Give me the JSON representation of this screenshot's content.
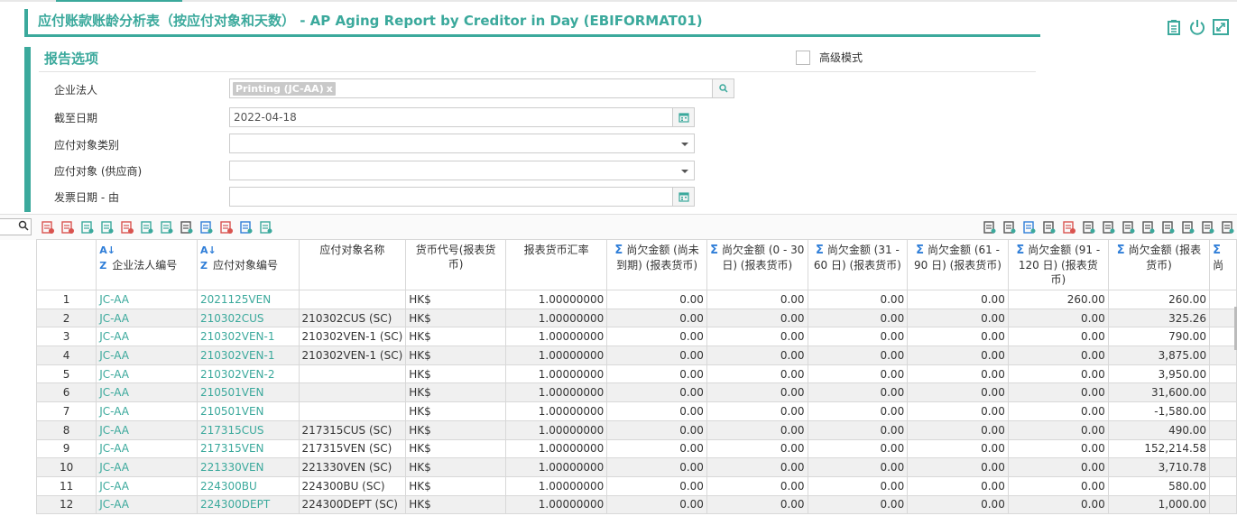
{
  "title": "应付账款账龄分析表（按应付对象和天数） - AP Aging Report by Creditor in Day (EBIFORMAT01)",
  "options": {
    "header": "报告选项",
    "advanced_mode": "高级模式",
    "fields": [
      {
        "label": "企业法人",
        "chip": "Printing (JC-AA)",
        "chip_x": "x",
        "value": ""
      },
      {
        "label": "截至日期",
        "value": "2022-04-18"
      },
      {
        "label": "应付对象类别",
        "value": ""
      },
      {
        "label": "应付对象 (供应商)",
        "value": ""
      },
      {
        "label": "发票日期 - 由",
        "value": ""
      }
    ]
  },
  "table": {
    "columns": [
      "",
      "企业法人编号",
      "应付对象编号",
      "应付对象名称",
      "货币代号(报表货币)",
      "报表货币汇率",
      "尚欠金额 (尚未到期) (报表货币)",
      "尚欠金额 (0 - 30 日) (报表货币)",
      "尚欠金额 (31 - 60 日) (报表货币)",
      "尚欠金额 (61 - 90 日) (报表货币)",
      "尚欠金额 (91 - 120 日) (报表货币)",
      "尚欠金额 (报表货币)",
      "尚"
    ],
    "rows": [
      [
        "1",
        "JC-AA",
        "2021125VEN",
        "",
        "HK$",
        "1.00000000",
        "0.00",
        "0.00",
        "0.00",
        "0.00",
        "260.00",
        "260.00"
      ],
      [
        "2",
        "JC-AA",
        "210302CUS",
        "210302CUS (SC)",
        "HK$",
        "1.00000000",
        "0.00",
        "0.00",
        "0.00",
        "0.00",
        "0.00",
        "325.26"
      ],
      [
        "3",
        "JC-AA",
        "210302VEN-1",
        "210302VEN-1 (SC)",
        "HK$",
        "1.00000000",
        "0.00",
        "0.00",
        "0.00",
        "0.00",
        "0.00",
        "790.00"
      ],
      [
        "4",
        "JC-AA",
        "210302VEN-1",
        "210302VEN-1 (SC)",
        "HK$",
        "1.00000000",
        "0.00",
        "0.00",
        "0.00",
        "0.00",
        "0.00",
        "3,875.00"
      ],
      [
        "5",
        "JC-AA",
        "210302VEN-2",
        "",
        "HK$",
        "1.00000000",
        "0.00",
        "0.00",
        "0.00",
        "0.00",
        "0.00",
        "3,950.00"
      ],
      [
        "6",
        "JC-AA",
        "210501VEN",
        "",
        "HK$",
        "1.00000000",
        "0.00",
        "0.00",
        "0.00",
        "0.00",
        "0.00",
        "31,600.00"
      ],
      [
        "7",
        "JC-AA",
        "210501VEN",
        "",
        "HK$",
        "1.00000000",
        "0.00",
        "0.00",
        "0.00",
        "0.00",
        "0.00",
        "-1,580.00"
      ],
      [
        "8",
        "JC-AA",
        "217315CUS",
        "217315CUS (SC)",
        "HK$",
        "1.00000000",
        "0.00",
        "0.00",
        "0.00",
        "0.00",
        "0.00",
        "490.00"
      ],
      [
        "9",
        "JC-AA",
        "217315VEN",
        "217315VEN (SC)",
        "HK$",
        "1.00000000",
        "0.00",
        "0.00",
        "0.00",
        "0.00",
        "0.00",
        "152,214.58"
      ],
      [
        "10",
        "JC-AA",
        "221330VEN",
        "221330VEN (SC)",
        "HK$",
        "1.00000000",
        "0.00",
        "0.00",
        "0.00",
        "0.00",
        "0.00",
        "3,710.78"
      ],
      [
        "11",
        "JC-AA",
        "224300BU",
        "224300BU (SC)",
        "HK$",
        "1.00000000",
        "0.00",
        "0.00",
        "0.00",
        "0.00",
        "0.00",
        "580.00"
      ],
      [
        "12",
        "JC-AA",
        "224300DEPT",
        "224300DEPT (SC)",
        "HK$",
        "1.00000000",
        "0.00",
        "0.00",
        "0.00",
        "0.00",
        "0.00",
        "1,000.00"
      ]
    ]
  },
  "colors": {
    "accent": "#3ba99c",
    "link": "#3ba99c",
    "sum_icon": "#2f7ed8"
  },
  "icons": {
    "top": [
      "clipboard-icon",
      "power-icon",
      "expand-icon"
    ],
    "toolbar_left": [
      "column-remove-icon",
      "grid-remove-icon",
      "run-icon",
      "add-icon",
      "remove-icon",
      "split-columns-icon",
      "fit-columns-icon",
      "chart-columns-icon",
      "sum-add-icon",
      "sum-remove-icon",
      "sum-view-icon",
      "export-group-icon"
    ],
    "toolbar_right": [
      "chart-icon",
      "report-icon",
      "formula-icon",
      "find-icon",
      "pdf-icon",
      "excel-icon",
      "print-icon",
      "screen-icon",
      "save-icon",
      "save-as-icon",
      "save-layout-icon",
      "copy-icon",
      "paste-icon"
    ]
  }
}
